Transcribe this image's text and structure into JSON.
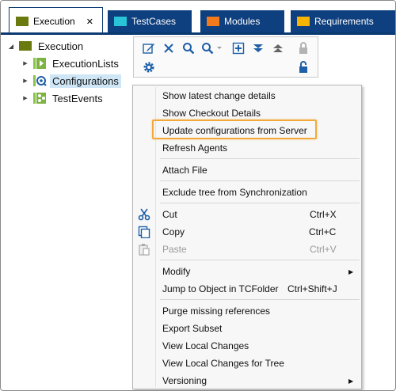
{
  "tabs": [
    {
      "label": "Execution",
      "color": "#6b7a0f",
      "active": true
    },
    {
      "label": "TestCases",
      "color": "#29c4d8",
      "active": false
    },
    {
      "label": "Modules",
      "color": "#f07a1c",
      "active": false
    },
    {
      "label": "Requirements",
      "color": "#f4b400",
      "active": false
    }
  ],
  "tab_close_glyph": "✕",
  "tree": {
    "root": {
      "label": "Execution",
      "icon": "folder-icon",
      "expander": "◢"
    },
    "children": [
      {
        "label": "ExecutionLists",
        "icon": "execution-list-icon",
        "expander": "▶"
      },
      {
        "label": "Configurations",
        "icon": "configurations-icon",
        "expander": "▶",
        "selected": true
      },
      {
        "label": "TestEvents",
        "icon": "test-events-icon",
        "expander": "▶"
      }
    ]
  },
  "toolbar": {
    "icons": [
      "edit-icon",
      "delete-icon",
      "search-icon",
      "search-options-icon",
      "add-icon",
      "expand-all-icon",
      "collapse-all-icon",
      "lock-icon",
      "settings-icon",
      "unlock-icon"
    ]
  },
  "context_menu": {
    "items": [
      {
        "label": "Show latest change details",
        "shortcut": ""
      },
      {
        "label": "Show Checkout Details",
        "shortcut": ""
      },
      {
        "label": "Update configurations from Server",
        "shortcut": "",
        "highlighted": true
      },
      {
        "label": "Refresh Agents",
        "shortcut": ""
      },
      {
        "label": "Attach File",
        "shortcut": ""
      },
      {
        "label": "Exclude tree from Synchronization",
        "shortcut": ""
      },
      {
        "label": "Cut",
        "shortcut": "Ctrl+X",
        "icon": "cut-icon"
      },
      {
        "label": "Copy",
        "shortcut": "Ctrl+C",
        "icon": "copy-icon"
      },
      {
        "label": "Paste",
        "shortcut": "Ctrl+V",
        "icon": "paste-icon",
        "disabled": true
      },
      {
        "label": "Modify",
        "shortcut": "",
        "submenu": true
      },
      {
        "label": "Jump to Object in TCFolder",
        "shortcut": "Ctrl+Shift+J"
      },
      {
        "label": "Purge missing references",
        "shortcut": ""
      },
      {
        "label": "Export Subset",
        "shortcut": ""
      },
      {
        "label": "View Local Changes",
        "shortcut": ""
      },
      {
        "label": "View Local Changes for Tree",
        "shortcut": ""
      },
      {
        "label": "Versioning",
        "shortcut": "",
        "submenu": true
      }
    ],
    "submenu_glyph": "▶",
    "highlight_color": "#f3a93a"
  }
}
